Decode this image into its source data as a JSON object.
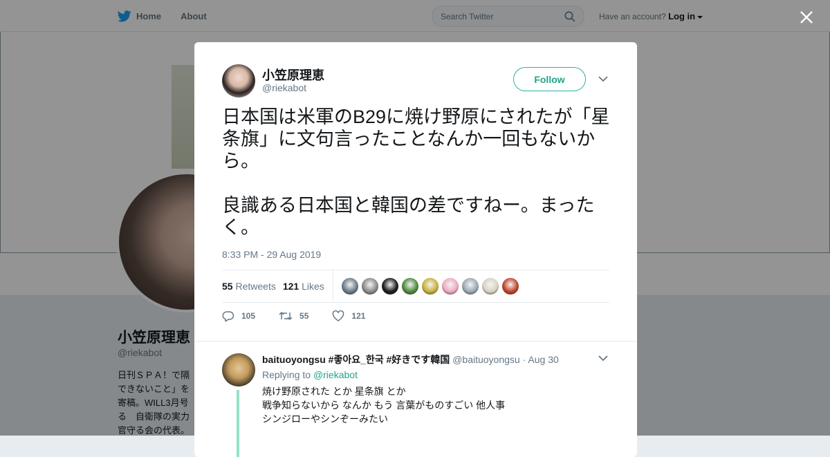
{
  "nav": {
    "home_label": "Home",
    "about_label": "About",
    "search_placeholder": "Search Twitter",
    "have_account": "Have an account?",
    "login_label": "Log in"
  },
  "profile": {
    "name": "小笠原理恵",
    "handle": "@riekabot",
    "bio": "日刊ＳＰＡ！で隔\nできないこと」を\n寄稿。WILL3月号\nる　自衛隊の実力\n官守る会の代表。"
  },
  "tweet": {
    "name": "小笠原理恵",
    "handle": "@riekabot",
    "follow_label": "Follow",
    "text": "日本国は米軍のB29に焼け野原にされたが「星条旗」に文句言ったことなんか一回もないから。\n\n良識ある日本国と韓国の差ですねー。まったく。",
    "timestamp": "8:33 PM - 29 Aug 2019",
    "retweets_count": "55",
    "retweets_label": "Retweets",
    "likes_count": "121",
    "likes_label": "Likes",
    "liker_avatar_colors": [
      "#6b7b8c",
      "#8a8a8a",
      "#1b1b1b",
      "#4f8a3c",
      "#c9b13a",
      "#f0a8c0",
      "#9aa9b6",
      "#d9d2c2",
      "#c0442a"
    ],
    "actions": {
      "replies": "105",
      "retweets": "55",
      "likes": "121"
    }
  },
  "reply": {
    "name": "baituoyongsu #좋아요_한국 #好きです韓国",
    "handle": "@baituoyongsu",
    "date": "· Aug 30",
    "replying_prefix": "Replying to",
    "replying_to": "@riekabot",
    "text": "焼け野原された とか 星条旗 とか\n戦争知らないから なんか もう 言葉がものすごい 他人事\nシンジローやシンぞーみたい"
  },
  "colors": {
    "accent": "#1fa587",
    "twitter_blue": "#1da1f2",
    "thread_line": "#94e2c6"
  }
}
